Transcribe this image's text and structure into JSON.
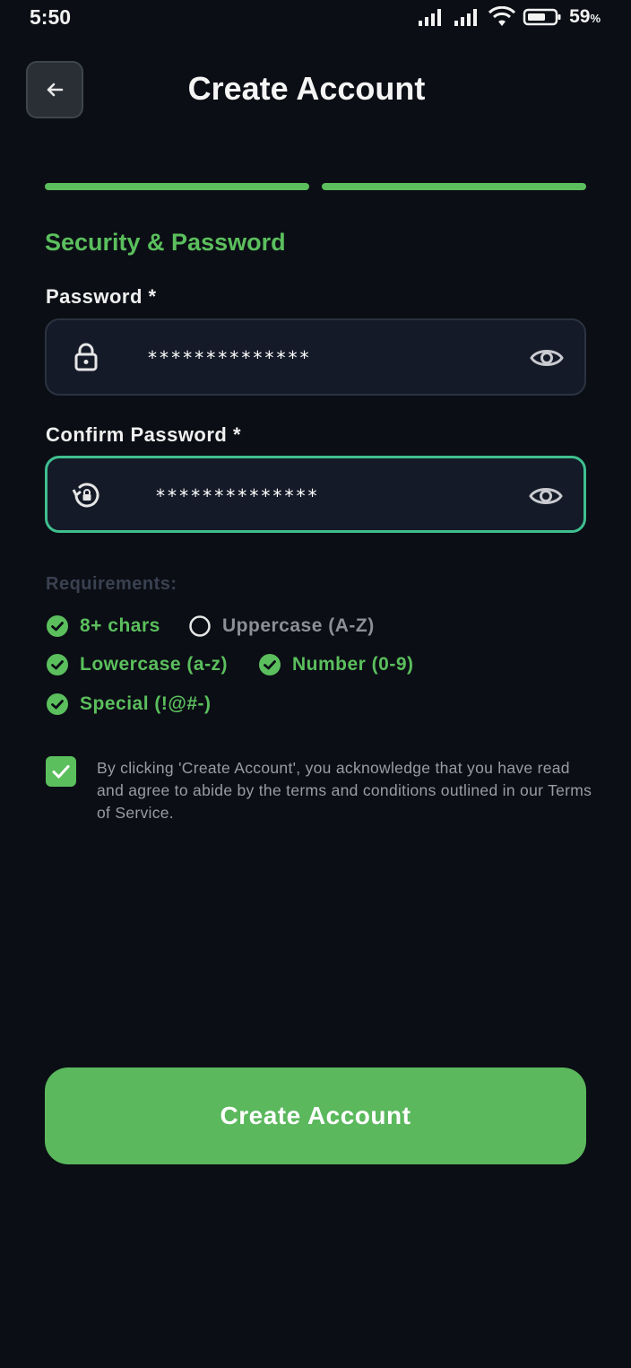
{
  "status_bar": {
    "time": "5:50",
    "battery_percent": "59",
    "battery_unit": "%",
    "icons": [
      "signal-icon",
      "signal-icon",
      "wifi-icon",
      "battery-icon"
    ]
  },
  "header": {
    "back_icon": "arrow-left-icon",
    "title": "Create Account"
  },
  "progress": {
    "steps_total": 2,
    "steps_completed": 2,
    "color": "#5bbf5d"
  },
  "section": {
    "title": "Security & Password"
  },
  "password": {
    "label": "Password *",
    "value": "**************",
    "lead_icon": "lock-icon",
    "toggle_icon": "eye-icon"
  },
  "confirm_password": {
    "label": "Confirm Password *",
    "value": "**************",
    "lead_icon": "lock-reset-icon",
    "toggle_icon": "eye-icon",
    "focused": true
  },
  "requirements": {
    "title": "Requirements:",
    "items": [
      {
        "label": "8+ chars",
        "met": true
      },
      {
        "label": "Uppercase (A-Z)",
        "met": false
      },
      {
        "label": "Lowercase (a-z)",
        "met": true
      },
      {
        "label": "Number (0-9)",
        "met": true
      },
      {
        "label": "Special (!@#-)",
        "met": true
      }
    ]
  },
  "terms": {
    "checked": true,
    "text": "By clicking 'Create Account', you acknowledge that you have read and agree to abide by the terms and conditions outlined in our Terms of Service."
  },
  "submit": {
    "label": "Create Account"
  },
  "colors": {
    "background": "#0b0e15",
    "accent": "#5bbf5d",
    "focus_border": "#3fbf8f",
    "field_bg": "#141a27"
  }
}
